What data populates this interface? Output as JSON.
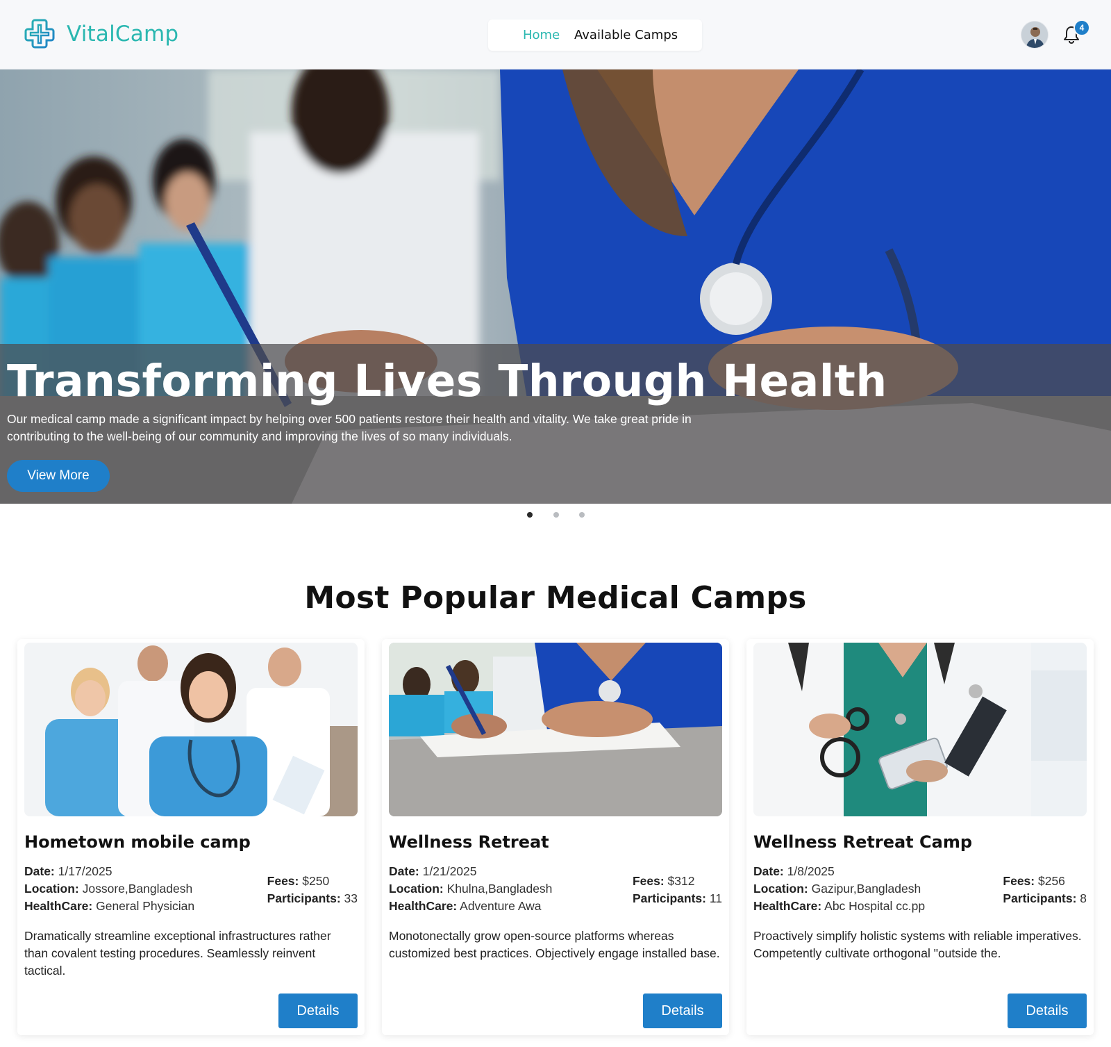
{
  "brand": {
    "name": "VitalCamp"
  },
  "nav": {
    "links": [
      {
        "label": "Home",
        "active": true
      },
      {
        "label": "Available Camps",
        "active": false
      }
    ],
    "notification_count": "4"
  },
  "hero": {
    "title": "Transforming Lives Through Health",
    "description": "Our medical camp made a significant impact by helping over 500 patients restore their health and vitality. We take great pride in contributing to the well-being of our community and improving the lives of so many individuals.",
    "button_label": "View More",
    "slide_count": 3,
    "active_slide": 1
  },
  "section": {
    "title": "Most Popular Medical Camps"
  },
  "camps": [
    {
      "title": "Hometown mobile camp",
      "date_label": "Date:",
      "date": "1/17/2025",
      "location_label": "Location:",
      "location": "Jossore,Bangladesh",
      "healthcare_label": "HealthCare:",
      "healthcare": "General Physician",
      "fees_label": "Fees:",
      "fees": "$250",
      "participants_label": "Participants:",
      "participants": "33",
      "description": "Dramatically streamline exceptional infrastructures rather than covalent testing procedures. Seamlessly reinvent tactical.",
      "button_label": "Details"
    },
    {
      "title": "Wellness Retreat",
      "date_label": "Date:",
      "date": "1/21/2025",
      "location_label": "Location:",
      "location": "Khulna,Bangladesh",
      "healthcare_label": "HealthCare:",
      "healthcare": "Adventure Awa",
      "fees_label": "Fees:",
      "fees": "$312",
      "participants_label": "Participants:",
      "participants": "11",
      "description": "Monotonectally grow open-source platforms whereas customized best practices. Objectively engage installed base.",
      "button_label": "Details"
    },
    {
      "title": "Wellness Retreat Camp",
      "date_label": "Date:",
      "date": "1/8/2025",
      "location_label": "Location:",
      "location": "Gazipur,Bangladesh",
      "healthcare_label": "HealthCare:",
      "healthcare": "Abc Hospital cc.pp",
      "fees_label": "Fees:",
      "fees": "$256",
      "participants_label": "Participants:",
      "participants": "8",
      "description": "Proactively simplify holistic systems with reliable imperatives. Competently cultivate orthogonal \"outside the.",
      "button_label": "Details"
    }
  ],
  "colors": {
    "brand_teal": "#2ab7b0",
    "primary_blue": "#1f7fc9",
    "navbar_bg": "#f7f8fa"
  },
  "icons": [
    "medical-cross-logo-icon",
    "user-avatar",
    "bell-icon"
  ]
}
